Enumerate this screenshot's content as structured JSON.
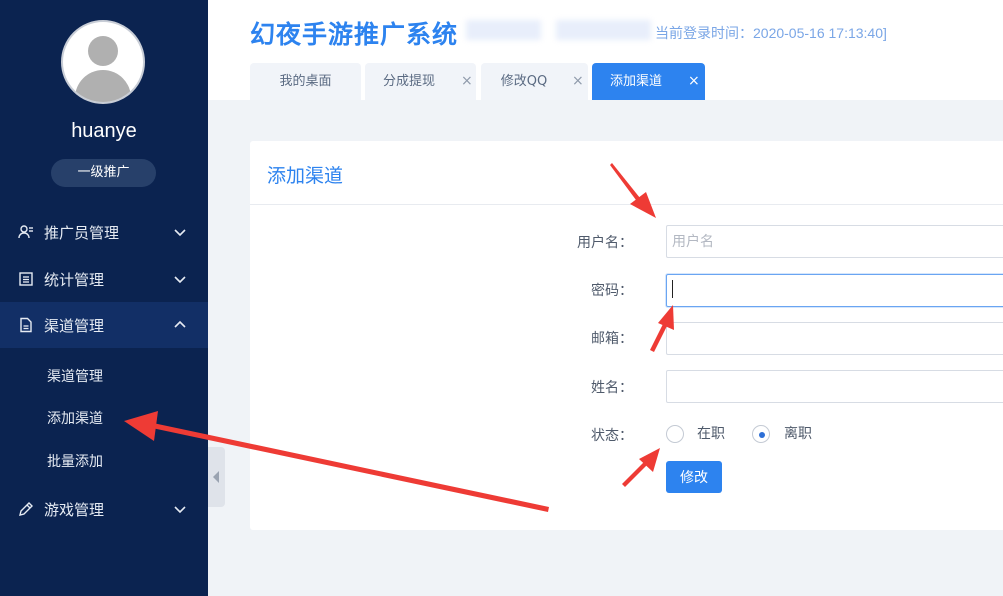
{
  "sidebar": {
    "username": "huanye",
    "level": "一级推广",
    "nav": [
      {
        "label": "推广员管理",
        "icon": "user-manage-icon",
        "expanded": false
      },
      {
        "label": "统计管理",
        "icon": "list-icon",
        "expanded": false
      },
      {
        "label": "渠道管理",
        "icon": "document-icon",
        "expanded": true
      },
      {
        "label": "游戏管理",
        "icon": "pencil-icon",
        "expanded": false
      }
    ],
    "channel_sub": [
      "渠道管理",
      "添加渠道",
      "批量添加"
    ]
  },
  "header": {
    "title": "幻夜手游推广系统",
    "login_time": "当前登录时间：2020-05-16 17:13:40]",
    "tabs": [
      {
        "label": "我的桌面",
        "closable": false,
        "active": false
      },
      {
        "label": "分成提现",
        "closable": true,
        "active": false
      },
      {
        "label": "修改QQ",
        "closable": true,
        "active": false
      },
      {
        "label": "添加渠道",
        "closable": true,
        "active": true
      }
    ]
  },
  "form": {
    "title": "添加渠道",
    "username_label": "用户名：",
    "username_placeholder": "用户名",
    "password_label": "密码：",
    "email_label": "邮箱：",
    "name_label": "姓名：",
    "status_label": "状态：",
    "status_options": [
      "在职",
      "离职"
    ],
    "status_selected": "离职",
    "submit_label": "修改"
  },
  "colors": {
    "sidebar_bg": "#0b2350",
    "accent": "#2d83ef",
    "annotation_arrow": "#ee3b35"
  }
}
